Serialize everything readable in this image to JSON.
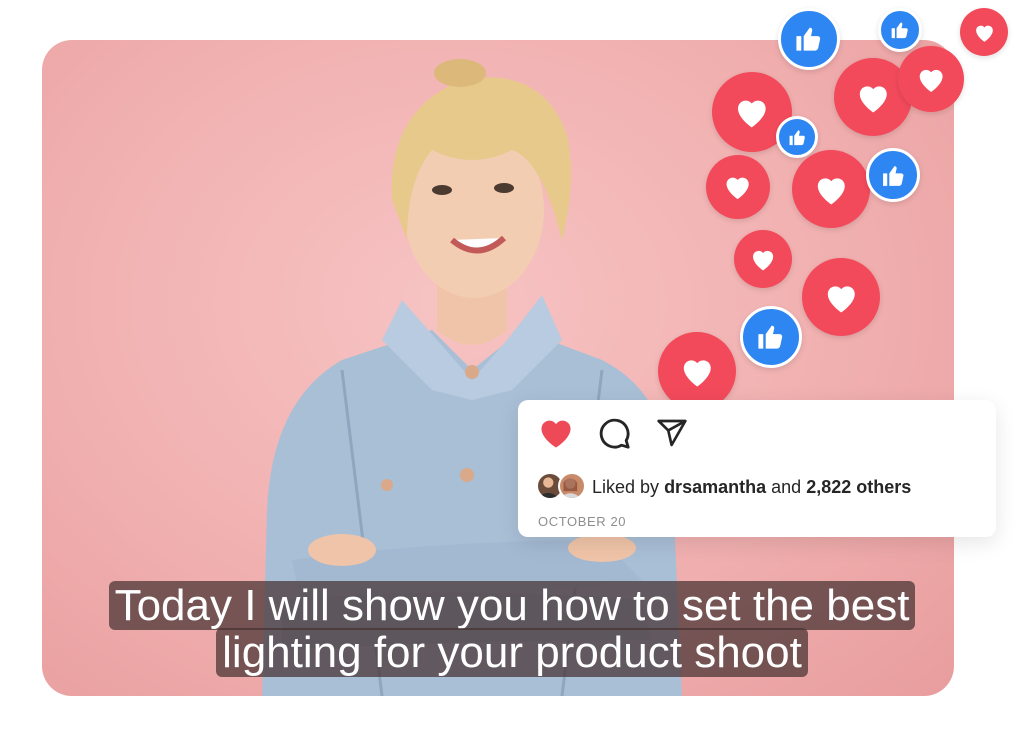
{
  "post": {
    "liked_by_prefix": "Liked by",
    "liked_by_user": "drsamantha",
    "liked_by_and": "and",
    "liked_by_others": "2,822 others",
    "date": "OCTOBER 20"
  },
  "caption": {
    "line1": "Today I will show you how to set the best",
    "line2": "lighting for your product shoot"
  },
  "colors": {
    "heart_red": "#f24a5b",
    "like_blue": "#2e86f2",
    "background_pink": "#f1b0b0"
  },
  "icons": [
    "heart-icon",
    "comment-icon",
    "share-icon",
    "thumbs-up-icon"
  ]
}
